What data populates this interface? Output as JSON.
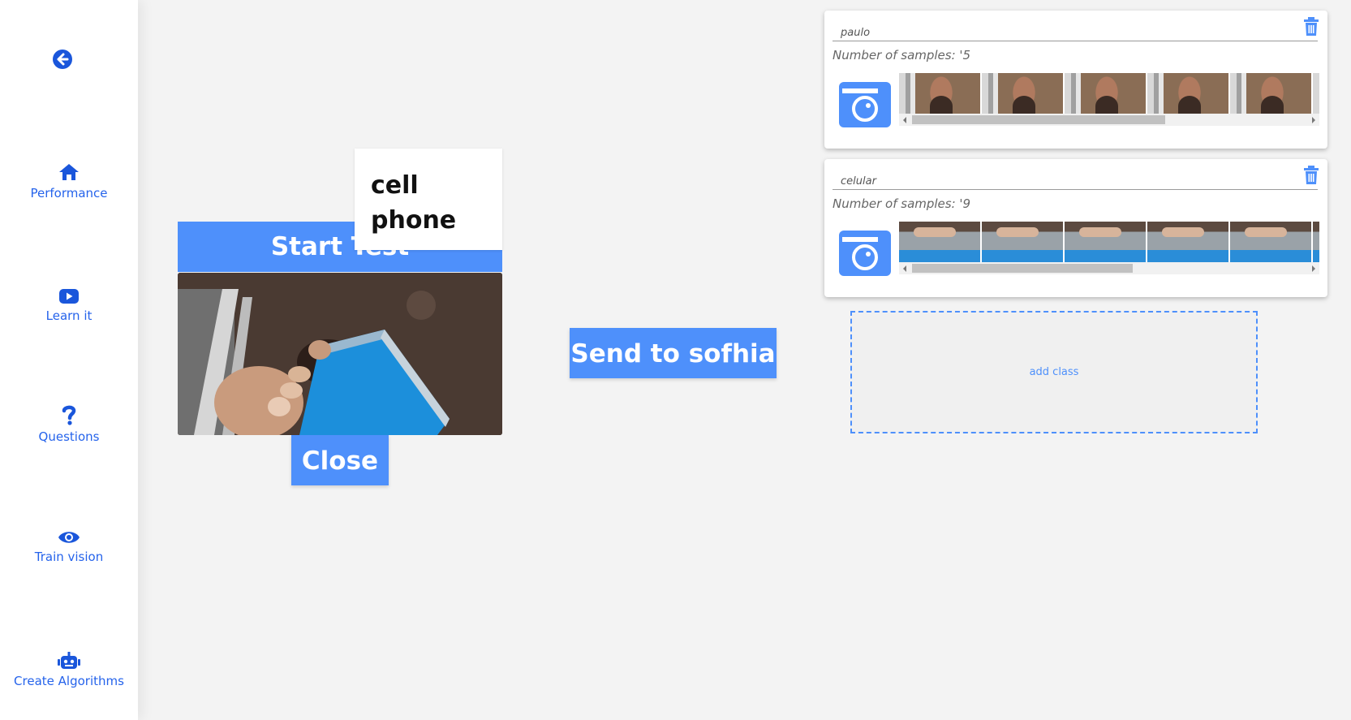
{
  "sidebar": {
    "back_icon": "arrow-left-circle-icon",
    "items": [
      {
        "label": "Performance",
        "icon": "home-icon"
      },
      {
        "label": "Learn it",
        "icon": "youtube-icon"
      },
      {
        "label": "Questions",
        "icon": "question-icon"
      },
      {
        "label": "Train vision",
        "icon": "eye-icon"
      },
      {
        "label": "Create Algorithms",
        "icon": "robot-icon"
      }
    ]
  },
  "prediction": {
    "label": "cell phone"
  },
  "buttons": {
    "start_test": "Start Test",
    "close": "Close",
    "send": "Send to sofhia"
  },
  "classes": [
    {
      "name": "paulo",
      "samples_text": "Number of samples: '5",
      "sample_count": 5,
      "thumb_kind": "person"
    },
    {
      "name": "celular",
      "samples_text": "Number of samples: '9",
      "sample_count": 9,
      "thumb_kind": "phone"
    }
  ],
  "add_class_label": "add class",
  "colors": {
    "accent": "#4e90fb",
    "nav_text": "#2563eb",
    "nav_icon": "#1a56db",
    "background": "#f3f3f3"
  }
}
